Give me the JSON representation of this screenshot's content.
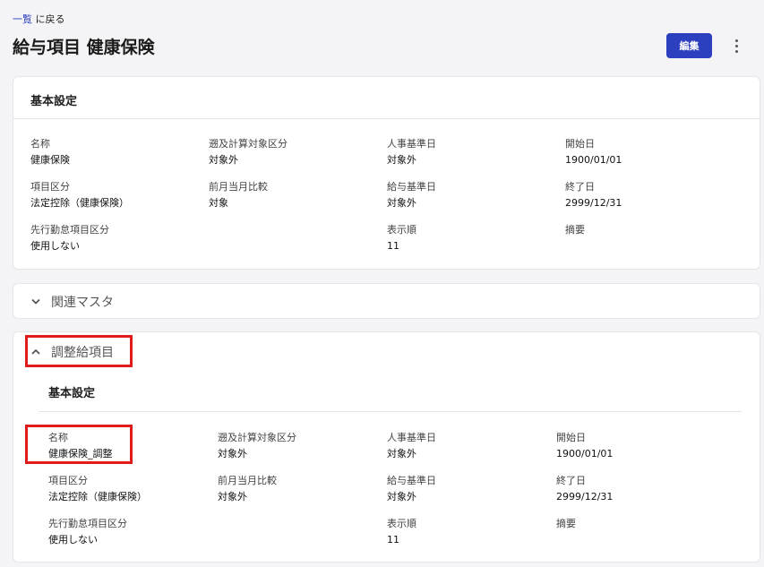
{
  "header": {
    "back_link_strong": "一覧",
    "back_link_rest": " に戻る",
    "title": "給与項目 健康保険",
    "edit_label": "編集",
    "more_icon": "more-vertical-icon"
  },
  "basic": {
    "title": "基本設定",
    "fields": {
      "name": {
        "label": "名称",
        "value": "健康保険"
      },
      "retro": {
        "label": "遡及計算対象区分",
        "value": "対象外"
      },
      "hr_date": {
        "label": "人事基準日",
        "value": "対象外"
      },
      "start": {
        "label": "開始日",
        "value": "1900/01/01"
      },
      "category": {
        "label": "項目区分",
        "value": "法定控除（健康保険）"
      },
      "compare": {
        "label": "前月当月比較",
        "value": "対象"
      },
      "pay_date": {
        "label": "給与基準日",
        "value": "対象外"
      },
      "end": {
        "label": "終了日",
        "value": "2999/12/31"
      },
      "attendance": {
        "label": "先行勤怠項目区分",
        "value": "使用しない"
      },
      "order": {
        "label": "表示順",
        "value": "11"
      },
      "memo": {
        "label": "摘要",
        "value": ""
      }
    }
  },
  "related": {
    "title": "関連マスタ",
    "icon": "chevron-down-icon"
  },
  "adjust": {
    "title": "調整給項目",
    "icon": "chevron-up-icon",
    "section_title": "基本設定",
    "highlight_color": "#e01b1b",
    "fields": {
      "name": {
        "label": "名称",
        "value": "健康保険_調整"
      },
      "retro": {
        "label": "遡及計算対象区分",
        "value": "対象外"
      },
      "hr_date": {
        "label": "人事基準日",
        "value": "対象外"
      },
      "start": {
        "label": "開始日",
        "value": "1900/01/01"
      },
      "category": {
        "label": "項目区分",
        "value": "法定控除（健康保険）"
      },
      "compare": {
        "label": "前月当月比較",
        "value": "対象外"
      },
      "pay_date": {
        "label": "給与基準日",
        "value": "対象外"
      },
      "end": {
        "label": "終了日",
        "value": "2999/12/31"
      },
      "attendance": {
        "label": "先行勤怠項目区分",
        "value": "使用しない"
      },
      "order": {
        "label": "表示順",
        "value": "11"
      },
      "memo": {
        "label": "摘要",
        "value": ""
      }
    }
  },
  "colors": {
    "accent": "#2b3fbf",
    "background": "#f4f4f6",
    "card": "#ffffff"
  }
}
